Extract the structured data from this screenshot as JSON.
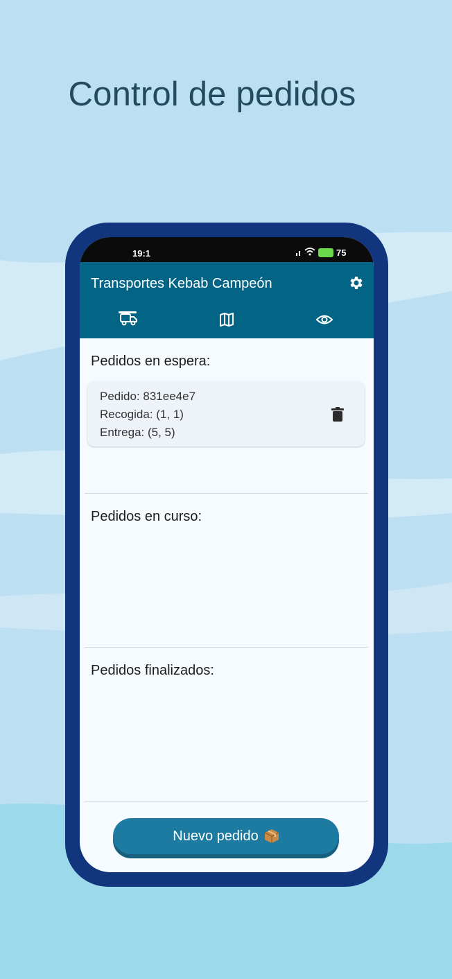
{
  "headline": "Control de pedidos",
  "status": {
    "time": "19:1",
    "battery": "75"
  },
  "app": {
    "title": "Transportes Kebab Campeón"
  },
  "tabs": [
    {
      "icon": "truck-icon"
    },
    {
      "icon": "map-icon"
    },
    {
      "icon": "eye-icon"
    }
  ],
  "sections": {
    "waiting": {
      "title": "Pedidos en espera:",
      "orders": [
        {
          "id_line": "Pedido: 831ee4e7",
          "pickup": "Recogida: (1, 1)",
          "delivery": "Entrega: (5, 5)"
        }
      ]
    },
    "in_progress": {
      "title": "Pedidos en curso:"
    },
    "finished": {
      "title": "Pedidos finalizados:"
    }
  },
  "new_order_button": {
    "label": "Nuevo pedido"
  },
  "colors": {
    "background": "#bddff2",
    "phone_frame": "#12367d",
    "app_bar": "#036485",
    "button": "#1d7aa0"
  }
}
